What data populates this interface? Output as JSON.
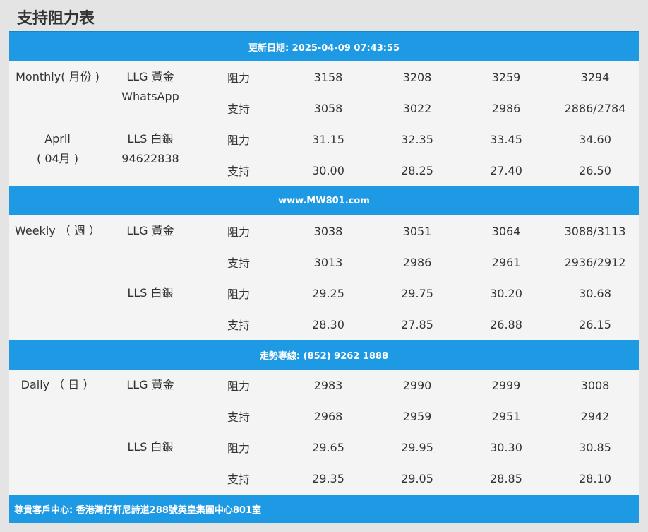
{
  "page_title": "支持阻力表",
  "header_banner": "更新日期: 2025-04-09 07:43:55",
  "mid_banner_1": "www.MW801.com",
  "mid_banner_2": "走勢專線: (852) 9262 1888",
  "footer_banner": "尊貴客戶中心: 香港灣仔軒尼詩道288號英皇集團中心801室",
  "sections": [
    {
      "period_line1": "Monthly( 月份 )",
      "period_line2": "April",
      "period_line3": "( 04月 )",
      "gold_label": "LLG 黃金",
      "gold_sub": "WhatsApp",
      "silver_label": "LLS 白銀",
      "silver_sub": "94622838",
      "rows": [
        {
          "type": "阻力",
          "values": [
            "3158",
            "3208",
            "3259",
            "3294"
          ]
        },
        {
          "type": "支持",
          "values": [
            "3058",
            "3022",
            "2986",
            "2886/2784"
          ]
        },
        {
          "type": "阻力",
          "values": [
            "31.15",
            "32.35",
            "33.45",
            "34.60"
          ]
        },
        {
          "type": "支持",
          "values": [
            "30.00",
            "28.25",
            "27.40",
            "26.50"
          ]
        }
      ]
    },
    {
      "period_line1": "Weekly （ 週 ）",
      "gold_label": "LLG 黃金",
      "silver_label": "LLS 白銀",
      "rows": [
        {
          "type": "阻力",
          "values": [
            "3038",
            "3051",
            "3064",
            "3088/3113"
          ]
        },
        {
          "type": "支持",
          "values": [
            "3013",
            "2986",
            "2961",
            "2936/2912"
          ]
        },
        {
          "type": "阻力",
          "values": [
            "29.25",
            "29.75",
            "30.20",
            "30.68"
          ]
        },
        {
          "type": "支持",
          "values": [
            "28.30",
            "27.85",
            "26.88",
            "26.15"
          ]
        }
      ]
    },
    {
      "period_line1": "Daily （ 日 ）",
      "gold_label": "LLG 黃金",
      "silver_label": "LLS 白銀",
      "rows": [
        {
          "type": "阻力",
          "values": [
            "2983",
            "2990",
            "2999",
            "3008"
          ]
        },
        {
          "type": "支持",
          "values": [
            "2968",
            "2959",
            "2951",
            "2942"
          ]
        },
        {
          "type": "阻力",
          "values": [
            "29.65",
            "29.95",
            "30.30",
            "30.85"
          ]
        },
        {
          "type": "支持",
          "values": [
            "29.35",
            "29.05",
            "28.85",
            "28.10"
          ]
        }
      ]
    }
  ],
  "colors": {
    "banner": "#1e9ae4",
    "table_bg": "#f4f4f4",
    "page_bg": "#e4e4e4",
    "text": "#333333"
  }
}
